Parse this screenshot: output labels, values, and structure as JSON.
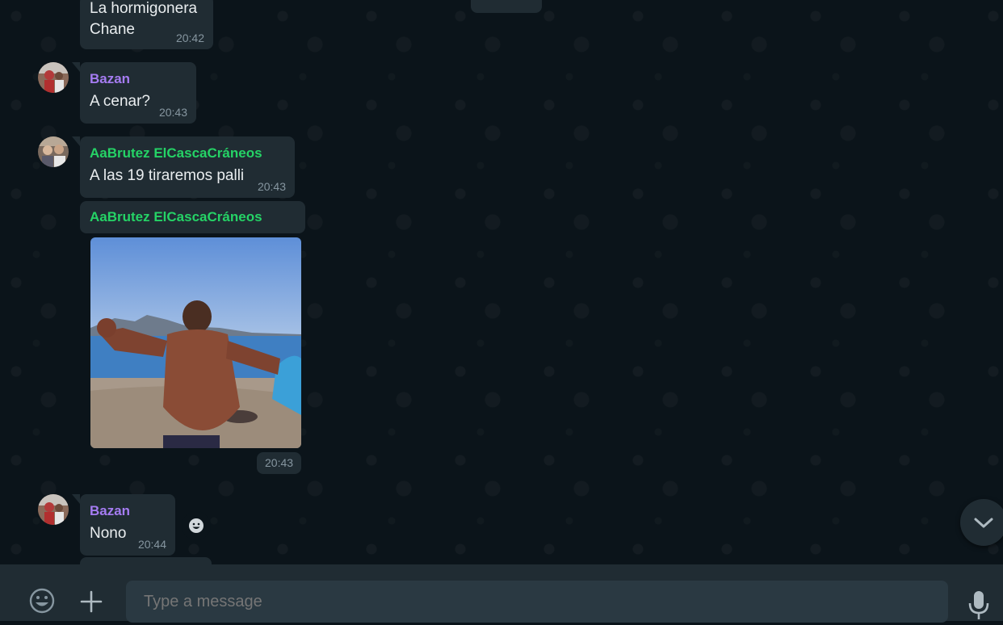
{
  "messages": [
    {
      "lines": [
        "La hormigonera",
        "Chane"
      ],
      "time": "20:42"
    },
    {
      "sender": "Bazan",
      "sender_color": "#a57cf2",
      "text": "A cenar?",
      "time": "20:43"
    },
    {
      "sender": "AaBrutez ElCascaCráneos",
      "sender_color": "#25d366",
      "text": "A las 19 tiraremos palli",
      "time": "20:43"
    },
    {
      "sender": "AaBrutez ElCascaCráneos",
      "sender_color": "#25d366",
      "type": "image",
      "time": "20:43"
    },
    {
      "sender": "Bazan",
      "sender_color": "#a57cf2",
      "text": "Nono",
      "time": "20:44"
    }
  ],
  "composer": {
    "placeholder": "Type a message",
    "emoji_icon": "emoji-icon",
    "attach_icon": "plus-icon",
    "mic_icon": "microphone-icon"
  },
  "scroll_icon": "chevron-down-icon",
  "react_icon": "smiley-react-icon"
}
